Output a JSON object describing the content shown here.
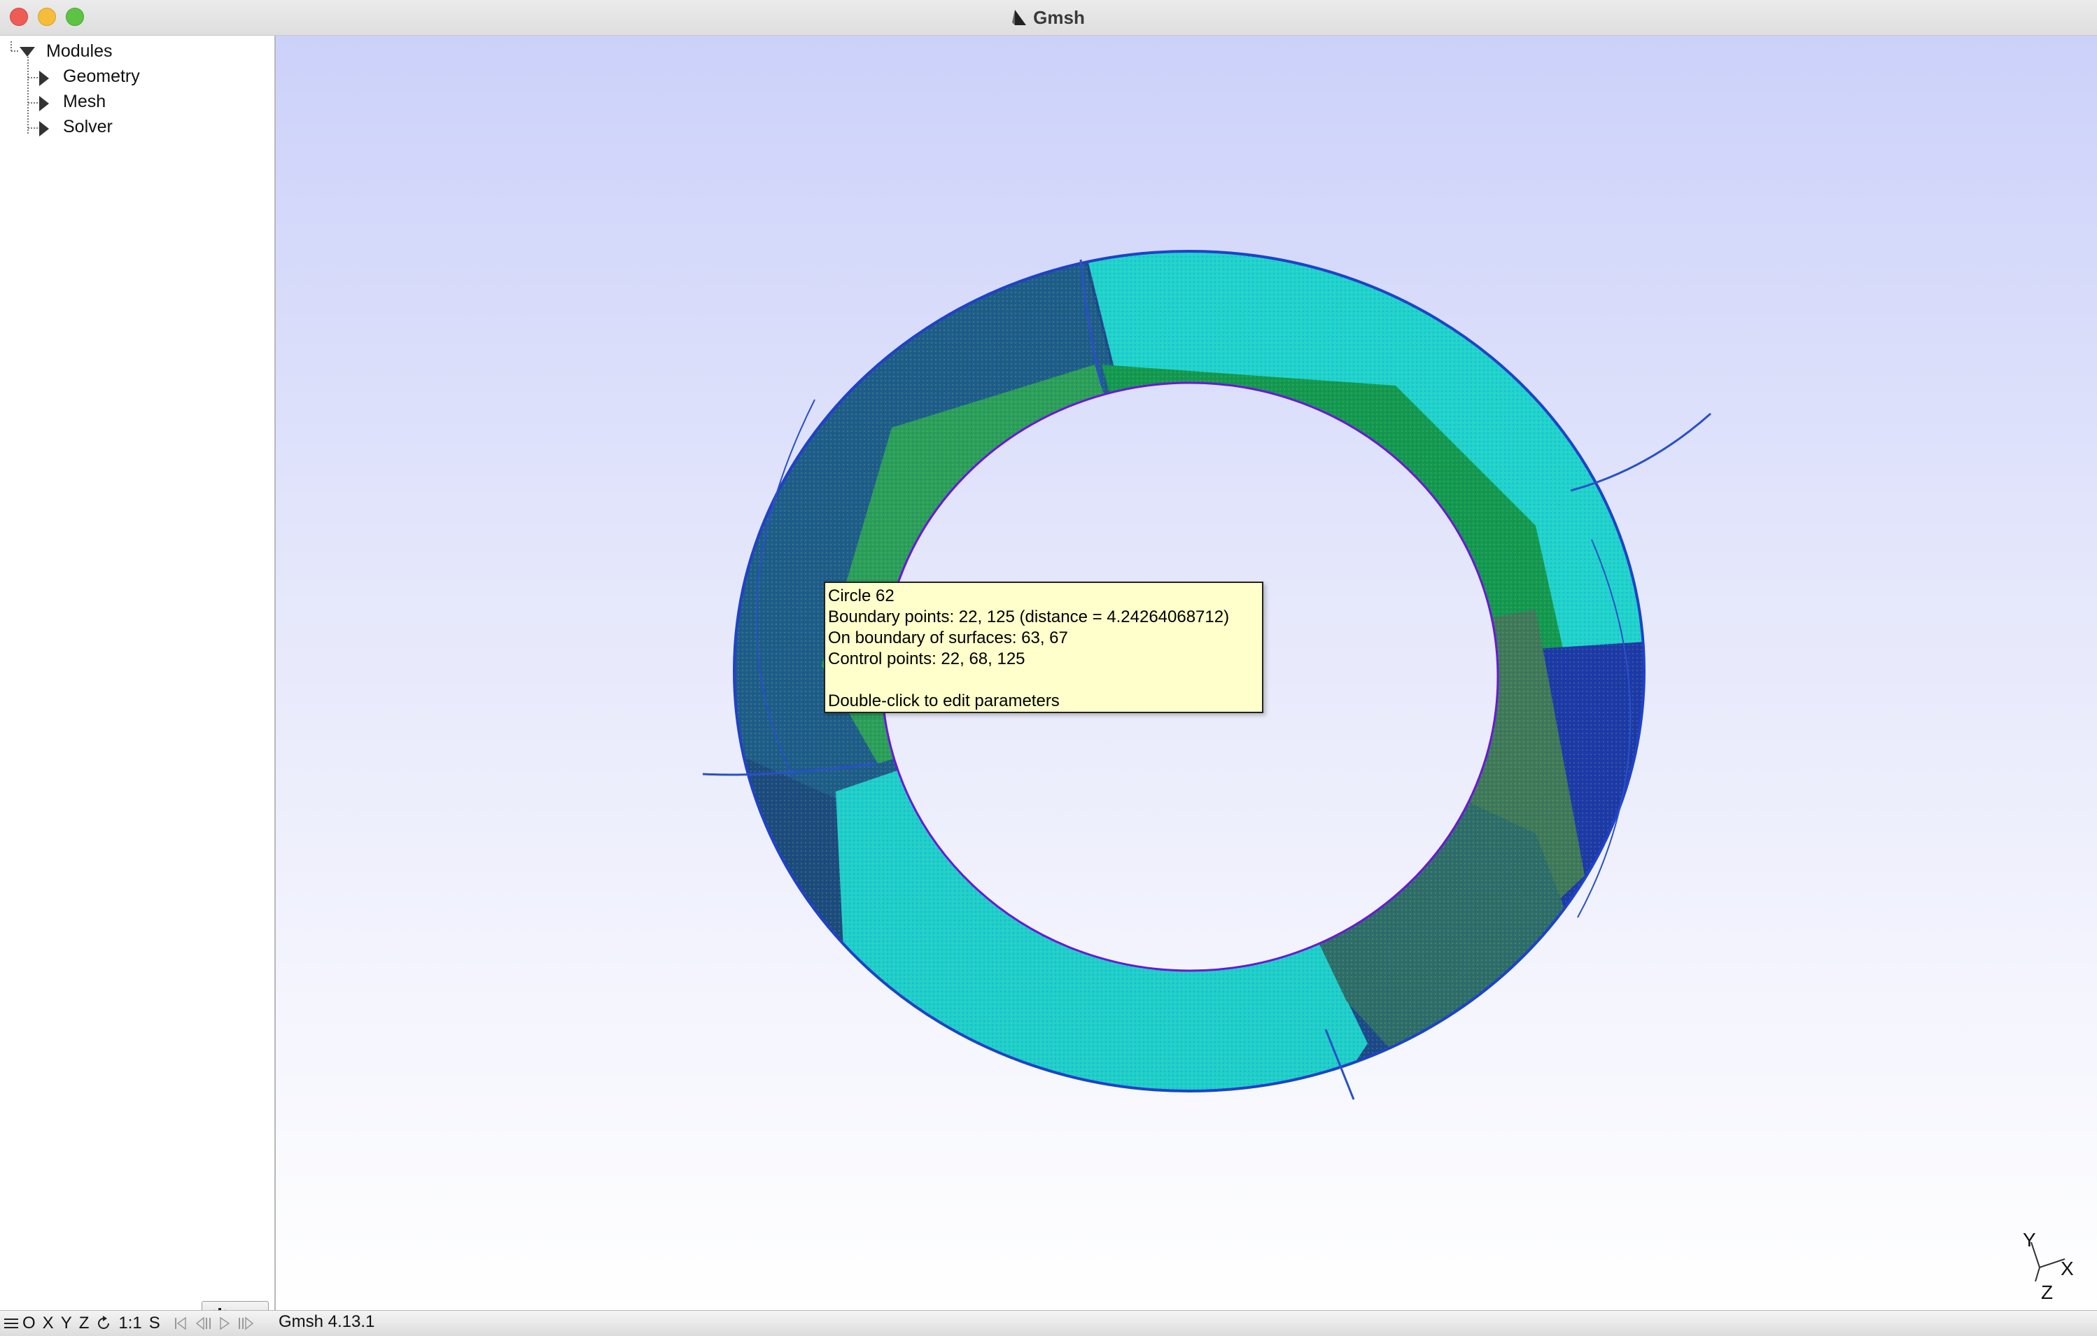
{
  "window": {
    "title": "Gmsh"
  },
  "tree": {
    "root": "Modules",
    "items": [
      {
        "label": "Geometry"
      },
      {
        "label": "Mesh"
      },
      {
        "label": "Solver"
      }
    ]
  },
  "tooltip": {
    "line1": "Circle 62",
    "line2": "Boundary points: 22, 125 (distance = 4.24264068712)",
    "line3": "On boundary of surfaces: 63, 67",
    "line4": "Control points: 22, 68, 125",
    "line5": "Double-click to edit parameters"
  },
  "axes": {
    "x": "X",
    "y": "Y",
    "z": "Z"
  },
  "statusbar": {
    "btn_o": "O",
    "btn_x": "X",
    "btn_y": "Y",
    "btn_z": "Z",
    "btn_scale": "1:1",
    "btn_s": "S",
    "message": "Gmsh 4.13.1"
  },
  "icons": {
    "menu": "hamburger-icon",
    "rotate": "rotate-icon",
    "gear": "gear-icon",
    "dropdown": "chevron-down-icon",
    "anim_first": "first-frame-icon",
    "anim_prev": "previous-frame-icon",
    "anim_play": "play-icon",
    "anim_next": "next-frame-icon"
  },
  "colors": {
    "viewport_top": "#ccd1fa",
    "viewport_bottom": "#ffffff",
    "tooltip_bg": "#ffffcc",
    "mesh_cyan": "#1fd6d0",
    "mesh_green": "#0d9a48",
    "mesh_blue": "#1a3ea8"
  }
}
